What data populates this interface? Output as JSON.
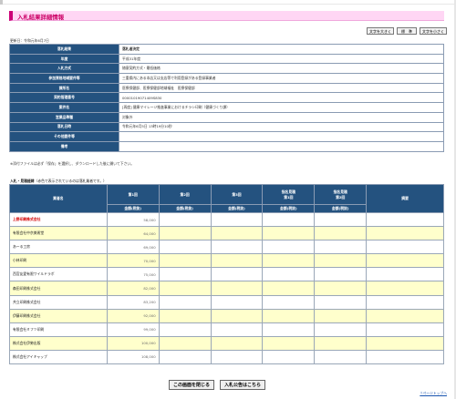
{
  "page": {
    "title": "入札結果詳細情報",
    "updated": "更新日：令和元年6月7日",
    "note": "※添付ファイルは必ず「保存」を選択し、ダウンロードした後に開いて下さい。",
    "top_link": "↑ページトップへ"
  },
  "font_buttons": {
    "large": "文字を大きく",
    "standard": "標　準",
    "small": "文字を小さく"
  },
  "info": {
    "rows": [
      {
        "label": "落札結果",
        "value": "落札者決定",
        "bold": true
      },
      {
        "label": "年度",
        "value": "平成31年度"
      },
      {
        "label": "入札方式",
        "value": "随意契約方式・最低価格"
      },
      {
        "label": "参加資格地域要件等",
        "value": "三重県内にある本店又は支店等で利用登録がある登録事業者"
      },
      {
        "label": "課所名",
        "value": "医療保健部、医療保健部地域福祉　医療保健部"
      },
      {
        "label": "契約管理番号",
        "value": "00001019071409S830"
      },
      {
        "label": "案件名",
        "value": "[再度] 健康マイレージ推進事業におけるチラシ印刷（健康づくり課）"
      },
      {
        "label": "営業品準種",
        "value": "対象外"
      },
      {
        "label": "落札日時",
        "value": "令和元年6月5日 13時19分10秒"
      },
      {
        "label": "その他要件等",
        "value": ""
      },
      {
        "label": "備考",
        "value": ""
      }
    ]
  },
  "bids": {
    "heading": "入札・見積経緯",
    "heading_note": "（赤色で表示されているのは落札業者です。）",
    "columns": {
      "name": "業者名",
      "r1": "第1回",
      "r2": "第2回",
      "r3": "第3回",
      "d1": "指名見積\n第1回",
      "d2": "指名見積\n第2回",
      "remarks": "摘要",
      "amount_label": "金額(税抜)"
    },
    "rows": [
      {
        "name": "上野印刷株式会社",
        "amount": "58,000",
        "winner": true
      },
      {
        "name": "有限会社中京美術堂",
        "amount": "64,000"
      },
      {
        "name": "あーる工房",
        "amount": "69,000"
      },
      {
        "name": "小林印刷",
        "amount": "70,000"
      },
      {
        "name": "西宮友愛有限ワイルドラボ",
        "amount": "75,000"
      },
      {
        "name": "森田印刷株式会社",
        "amount": "82,000"
      },
      {
        "name": "共立印刷株式会社",
        "amount": "83,200"
      },
      {
        "name": "伊藤印刷株式会社",
        "amount": "92,000"
      },
      {
        "name": "有限会社ミフツ印刷",
        "amount": "99,000"
      },
      {
        "name": "株式会社伊勢出版",
        "amount": "100,000"
      },
      {
        "name": "株式会社アイキャップ",
        "amount": "108,000"
      }
    ]
  },
  "buttons": {
    "close": "この画面を閉じる",
    "notice": "入札公告はこちら"
  },
  "colors": {
    "header_bg": "#24527f",
    "title_bg": "#ffd6f4",
    "title_accent": "#cc0077",
    "stripe": "#ffffcc",
    "winner": "#d40000"
  }
}
